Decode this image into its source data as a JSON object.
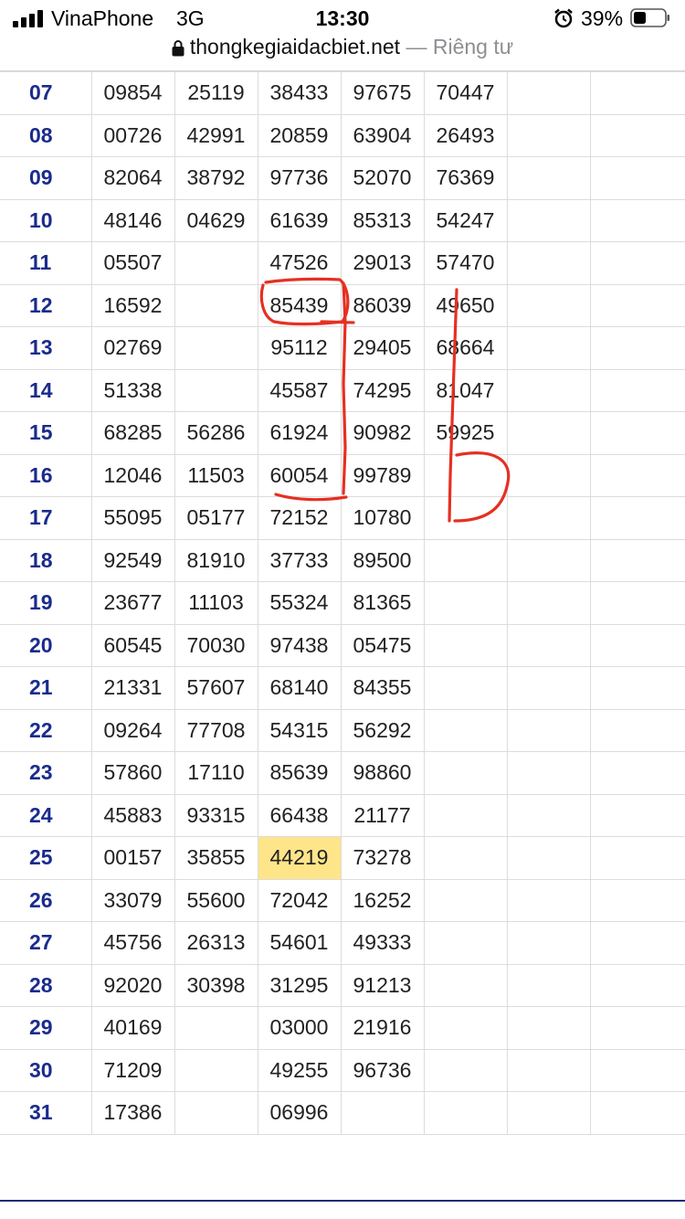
{
  "status_bar": {
    "carrier": "VinaPhone",
    "network": "3G",
    "time": "13:30",
    "battery_percent": "39%"
  },
  "browser": {
    "domain": "thongkegiaidacbiet.net",
    "separator": " — ",
    "privacy_label": "Riêng tư"
  },
  "colors": {
    "day_text": "#1a2b8c",
    "highlight": "#ffe58a",
    "annotation": "#e53022",
    "bottom_rule": "#1e2a78"
  },
  "table": {
    "rows": [
      {
        "day": "07",
        "values": [
          "09854",
          "25119",
          "38433",
          "97675",
          "70447",
          "",
          ""
        ]
      },
      {
        "day": "08",
        "values": [
          "00726",
          "42991",
          "20859",
          "63904",
          "26493",
          "",
          ""
        ]
      },
      {
        "day": "09",
        "values": [
          "82064",
          "38792",
          "97736",
          "52070",
          "76369",
          "",
          ""
        ]
      },
      {
        "day": "10",
        "values": [
          "48146",
          "04629",
          "61639",
          "85313",
          "54247",
          "",
          ""
        ]
      },
      {
        "day": "11",
        "values": [
          "05507",
          "",
          "47526",
          "29013",
          "57470",
          "",
          ""
        ]
      },
      {
        "day": "12",
        "values": [
          "16592",
          "",
          "85439",
          "86039",
          "49650",
          "",
          ""
        ]
      },
      {
        "day": "13",
        "values": [
          "02769",
          "",
          "95112",
          "29405",
          "68664",
          "",
          ""
        ]
      },
      {
        "day": "14",
        "values": [
          "51338",
          "",
          "45587",
          "74295",
          "81047",
          "",
          ""
        ]
      },
      {
        "day": "15",
        "values": [
          "68285",
          "56286",
          "61924",
          "90982",
          "59925",
          "",
          ""
        ]
      },
      {
        "day": "16",
        "values": [
          "12046",
          "11503",
          "60054",
          "99789",
          "",
          "",
          ""
        ]
      },
      {
        "day": "17",
        "values": [
          "55095",
          "05177",
          "72152",
          "10780",
          "",
          "",
          ""
        ]
      },
      {
        "day": "18",
        "values": [
          "92549",
          "81910",
          "37733",
          "89500",
          "",
          "",
          ""
        ]
      },
      {
        "day": "19",
        "values": [
          "23677",
          "11103",
          "55324",
          "81365",
          "",
          "",
          ""
        ]
      },
      {
        "day": "20",
        "values": [
          "60545",
          "70030",
          "97438",
          "05475",
          "",
          "",
          ""
        ]
      },
      {
        "day": "21",
        "values": [
          "21331",
          "57607",
          "68140",
          "84355",
          "",
          "",
          ""
        ]
      },
      {
        "day": "22",
        "values": [
          "09264",
          "77708",
          "54315",
          "56292",
          "",
          "",
          ""
        ]
      },
      {
        "day": "23",
        "values": [
          "57860",
          "17110",
          "85639",
          "98860",
          "",
          "",
          ""
        ]
      },
      {
        "day": "24",
        "values": [
          "45883",
          "93315",
          "66438",
          "21177",
          "",
          "",
          ""
        ]
      },
      {
        "day": "25",
        "values": [
          "00157",
          "35855",
          "44219",
          "73278",
          "",
          "",
          ""
        ],
        "highlight_col": 2
      },
      {
        "day": "26",
        "values": [
          "33079",
          "55600",
          "72042",
          "16252",
          "",
          "",
          ""
        ]
      },
      {
        "day": "27",
        "values": [
          "45756",
          "26313",
          "54601",
          "49333",
          "",
          "",
          ""
        ]
      },
      {
        "day": "28",
        "values": [
          "92020",
          "30398",
          "31295",
          "91213",
          "",
          "",
          ""
        ]
      },
      {
        "day": "29",
        "values": [
          "40169",
          "",
          "03000",
          "21916",
          "",
          "",
          ""
        ]
      },
      {
        "day": "30",
        "values": [
          "71209",
          "",
          "49255",
          "96736",
          "",
          "",
          ""
        ]
      },
      {
        "day": "31",
        "values": [
          "17386",
          "",
          "06996",
          "",
          "",
          "",
          ""
        ]
      }
    ]
  }
}
